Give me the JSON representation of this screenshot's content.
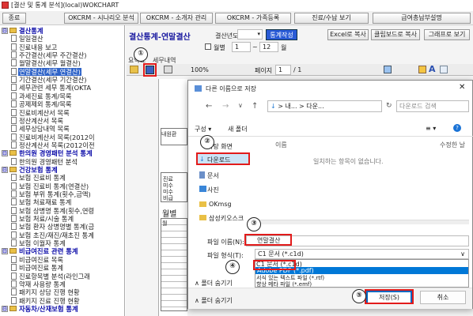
{
  "window": {
    "title": "[결산 및 통계 분석](local)WOKCHART"
  },
  "topbar": {
    "items": [
      "종료",
      "OKCRM - 시나리오 분석",
      "OKCRM - 소개자 관리",
      "OKCRM - 가족등록",
      "진료/수납 보기",
      "급여총납부설명"
    ]
  },
  "sidebar": {
    "items": [
      {
        "label": "결산통계",
        "type": "group",
        "toggle": "⊟"
      },
      {
        "label": "일일결산",
        "type": "item"
      },
      {
        "label": "진료내용 보고",
        "type": "item"
      },
      {
        "label": "주간결산(세무 주간결산)",
        "type": "item"
      },
      {
        "label": "월말결산(세무 월결산)",
        "type": "item"
      },
      {
        "label": "연말결산(세무 연결산)",
        "type": "item",
        "selected": true
      },
      {
        "label": "기간결산(세무 기간결산)",
        "type": "item"
      },
      {
        "label": "세무관련 세무 통계(OKTA",
        "type": "item"
      },
      {
        "label": "과세진료 통계/목록",
        "type": "item"
      },
      {
        "label": "공제제외 통계/목록",
        "type": "item"
      },
      {
        "label": "진료비계산서 목록",
        "type": "item"
      },
      {
        "label": "정산계산서 목록",
        "type": "item"
      },
      {
        "label": "세무상담내역 목록",
        "type": "item"
      },
      {
        "label": "진료비계산서 목록(2012이",
        "type": "item"
      },
      {
        "label": "정산계산서 목록(2012이전",
        "type": "item"
      },
      {
        "label": "한의원 경영패턴 분석 통계",
        "type": "group",
        "toggle": "⊟"
      },
      {
        "label": "한의원 경영패턴 분석",
        "type": "item"
      },
      {
        "label": "건강보험 통계",
        "type": "group",
        "toggle": "⊟"
      },
      {
        "label": "보험 진료비 통계",
        "type": "item"
      },
      {
        "label": "보험 진료비 통계(연결산)",
        "type": "item"
      },
      {
        "label": "보험 부위 통계(횟수,금액)",
        "type": "item"
      },
      {
        "label": "보험 처료재료 통계",
        "type": "item"
      },
      {
        "label": "보험 상병명 통계(횟수,연령",
        "type": "item"
      },
      {
        "label": "보험 처료/시술 통계",
        "type": "item"
      },
      {
        "label": "보험 환자 상병명별 통계(금",
        "type": "item"
      },
      {
        "label": "보험 초진/재진/재초진 통계",
        "type": "item"
      },
      {
        "label": "보험 이월자 통계",
        "type": "item"
      },
      {
        "label": "비급여진료 관련 통계",
        "type": "group",
        "toggle": "⊟"
      },
      {
        "label": "비급여진료 목록",
        "type": "item"
      },
      {
        "label": "비급여진료 통계",
        "type": "item"
      },
      {
        "label": "진료항목별 분석(라인그래",
        "type": "item"
      },
      {
        "label": "약재 사용량 통계",
        "type": "item"
      },
      {
        "label": "패키지 상담 진행 현황",
        "type": "item"
      },
      {
        "label": "패키지 진료 진행 현황",
        "type": "item"
      },
      {
        "label": "자동차/산재보험 통계",
        "type": "group",
        "toggle": "⊟"
      }
    ]
  },
  "main": {
    "title": "결산통계-연말결산",
    "year_label": "결산년도",
    "year_value": "",
    "stat_button": "통계작성",
    "excel_button": "Excel로 복사",
    "clipboard_button": "클립보드로 복사",
    "graph_button": "그래프로 보기",
    "monthly_check": "월별",
    "month_from": "1",
    "month_to": "12",
    "month_suffix": "월",
    "tab_summary": "요약표",
    "tab_detail": "세무내역",
    "zoom": "100%",
    "page_label": "페이지",
    "page_value": "1",
    "page_total": "/ 1",
    "report_fragments": [
      "내원환",
      "진료",
      "미수",
      "미수",
      "비급",
      "월별",
      "월",
      "예상",
      "내원"
    ]
  },
  "dialog": {
    "title": "다른 이름으로 저장",
    "path": "> 내... > 다운...",
    "search_placeholder": "다운로드 검색",
    "organize": "구성 ▾",
    "new_folder": "새 폴더",
    "nav_items": [
      "바탕 화면",
      "다운로드",
      "문서",
      "사진",
      "OKmsg",
      "삼성키오스크"
    ],
    "col_name": "이름",
    "col_modified": "수정한 날",
    "empty_message": "일치하는 항목이 없습니다.",
    "filename_label": "파일 이름(N):",
    "filename_value": "연말결산",
    "filetype_label": "파일 형식(T):",
    "filetype_value": "C1 문서 (*.c1d)",
    "filetype_options": [
      "C1 문서 (*.c1d)",
      "Adobe PDF (*.pdf)",
      "서식 있는 텍스트 파일 (*.rtf)",
      "향상 메타 파일 (*.emf)"
    ],
    "hide_folders_top": "폴더 숨기기",
    "hide_folders_bottom": "폴더 숨기기",
    "save_button": "저장(S)",
    "cancel_button": "취소"
  },
  "callouts": [
    "①",
    "②",
    "③",
    "④",
    "⑤"
  ],
  "colors": {
    "callout_red": "#e21b1b",
    "selection_blue": "#3064c8",
    "group_text": "#0a0aa8"
  }
}
